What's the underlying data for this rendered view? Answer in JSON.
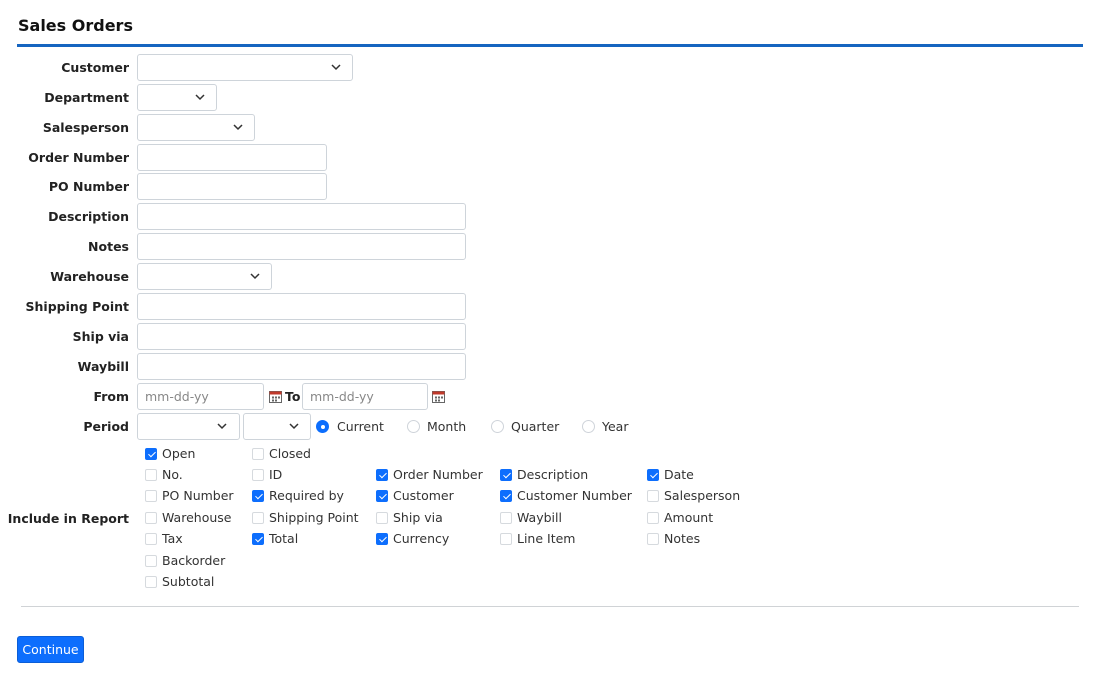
{
  "header": {
    "title": "Sales Orders"
  },
  "form": {
    "customer_label": "Customer",
    "department_label": "Department",
    "salesperson_label": "Salesperson",
    "order_number_label": "Order Number",
    "po_number_label": "PO Number",
    "description_label": "Description",
    "notes_label": "Notes",
    "warehouse_label": "Warehouse",
    "shipping_point_label": "Shipping Point",
    "ship_via_label": "Ship via",
    "waybill_label": "Waybill",
    "from_label": "From",
    "to_label": "To",
    "from_placeholder": "mm-dd-yy",
    "to_placeholder": "mm-dd-yy",
    "period_label": "Period",
    "period_options": [
      {
        "label": "Current",
        "selected": true
      },
      {
        "label": "Month",
        "selected": false
      },
      {
        "label": "Quarter",
        "selected": false
      },
      {
        "label": "Year",
        "selected": false
      }
    ],
    "include_label": "Include in Report",
    "status_checks": [
      {
        "label": "Open",
        "checked": true
      },
      {
        "label": "Closed",
        "checked": false
      }
    ],
    "report_columns": [
      [
        {
          "label": "No.",
          "checked": false
        },
        {
          "label": "ID",
          "checked": false
        },
        {
          "label": "Order Number",
          "checked": true
        },
        {
          "label": "Description",
          "checked": true
        },
        {
          "label": "Date",
          "checked": true
        }
      ],
      [
        {
          "label": "PO Number",
          "checked": false
        },
        {
          "label": "Required by",
          "checked": true
        },
        {
          "label": "Customer",
          "checked": true
        },
        {
          "label": "Customer Number",
          "checked": true
        },
        {
          "label": "Salesperson",
          "checked": false
        }
      ],
      [
        {
          "label": "Warehouse",
          "checked": false
        },
        {
          "label": "Shipping Point",
          "checked": false
        },
        {
          "label": "Ship via",
          "checked": false
        },
        {
          "label": "Waybill",
          "checked": false
        },
        {
          "label": "Amount",
          "checked": false
        }
      ],
      [
        {
          "label": "Tax",
          "checked": false
        },
        {
          "label": "Total",
          "checked": true
        },
        {
          "label": "Currency",
          "checked": true
        },
        {
          "label": "Line Item",
          "checked": false
        },
        {
          "label": "Notes",
          "checked": false
        }
      ],
      [
        {
          "label": "Backorder",
          "checked": false
        }
      ],
      [
        {
          "label": "Subtotal",
          "checked": false
        }
      ]
    ]
  },
  "actions": {
    "continue_label": "Continue"
  },
  "colors": {
    "accent": "#0d6efd",
    "header_rule": "#1565c0"
  }
}
